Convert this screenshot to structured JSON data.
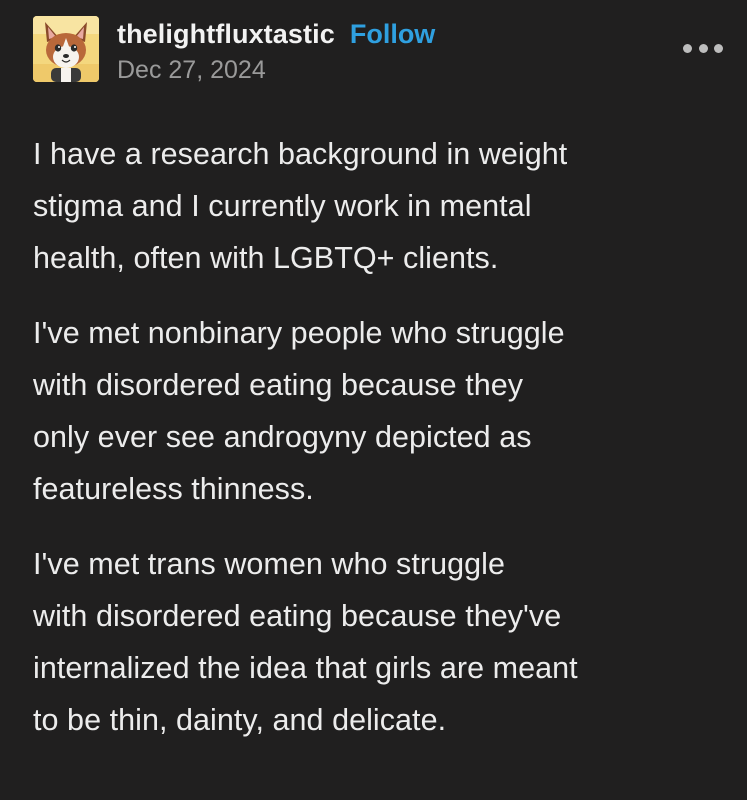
{
  "post": {
    "author": {
      "username": "thelightfluxtastic",
      "follow_label": "Follow",
      "date": "Dec 27, 2024",
      "avatar_icon": "fox-character-avatar-icon"
    },
    "more_icon": "more-options-icon",
    "paragraphs": [
      {
        "lines": [
          "I have a research background in weight",
          "stigma and I currently work in mental",
          "health, often with LGBTQ+ clients."
        ]
      },
      {
        "lines": [
          "I've met nonbinary people who struggle",
          "with disordered eating because they",
          "only ever see androgyny depicted as",
          "featureless thinness."
        ]
      },
      {
        "lines": [
          "I've met trans women who struggle",
          "with disordered eating because they've",
          "internalized the idea that girls are meant",
          "to be thin, dainty, and delicate."
        ]
      }
    ]
  },
  "colors": {
    "background": "#201f1f",
    "text": "#ececec",
    "follow": "#2fa0e0",
    "date": "#9a9a9a"
  }
}
